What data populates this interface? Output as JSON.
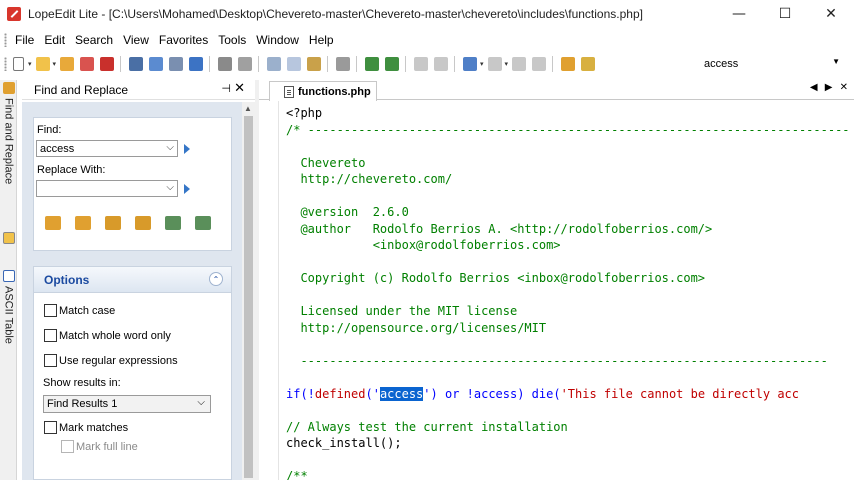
{
  "window": {
    "title": "LopeEdit Lite - [C:\\Users\\Mohamed\\Desktop\\Chevereto-master\\Chevereto-master\\chevereto\\includes\\functions.php]",
    "minimize": "—",
    "maximize": "☐",
    "close": "✕"
  },
  "menu": [
    "File",
    "Edit",
    "Search",
    "View",
    "Favorites",
    "Tools",
    "Window",
    "Help"
  ],
  "toolbar": {
    "search_value": "access",
    "icons": [
      "new-file-icon",
      "open-icon",
      "open-folder-icon",
      "close-icon",
      "close-all-icon",
      "save-icon",
      "save-as-icon",
      "save-all-icon",
      "project-icon",
      "print-icon",
      "print-preview-icon",
      "cut-icon",
      "copy-icon",
      "paste-icon",
      "select-all-icon",
      "indent-icon",
      "outdent-icon",
      "undo-icon",
      "redo-icon",
      "bookmark-icon",
      "next-bookmark-icon",
      "clear-bookmarks-icon",
      "find-icon",
      "find-in-files-icon"
    ]
  },
  "side_tabs": {
    "find_replace": "Find and Replace",
    "ascii_table": "ASCII Table"
  },
  "find_panel": {
    "title": "Find and Replace",
    "pin": "⊣",
    "close": "✕",
    "find_label": "Find:",
    "find_value": "access",
    "replace_label": "Replace With:",
    "replace_value": ""
  },
  "options": {
    "title": "Options",
    "match_case": "Match case",
    "match_whole_word": "Match whole word only",
    "use_regex": "Use regular expressions",
    "show_results_label": "Show results in:",
    "show_results_value": "Find Results 1",
    "mark_matches": "Mark matches",
    "mark_full_line": "Mark full line"
  },
  "editor": {
    "tab_label": "functions.php",
    "tab_nav": "◀ ▶ ✕",
    "lines": [
      [
        {
          "t": "<?php",
          "c": "plain"
        }
      ],
      [
        {
          "t": "/* ---------------------------------------------------------------------------",
          "c": "comment"
        }
      ],
      [
        {
          "t": "",
          "c": "plain"
        }
      ],
      [
        {
          "t": "  Chevereto",
          "c": "comment"
        }
      ],
      [
        {
          "t": "  http://chevereto.com/",
          "c": "comment"
        }
      ],
      [
        {
          "t": "",
          "c": "plain"
        }
      ],
      [
        {
          "t": "  @version  2.6.0",
          "c": "comment"
        }
      ],
      [
        {
          "t": "  @author   Rodolfo Berrios A. <http://rodolfoberrios.com/>",
          "c": "comment"
        }
      ],
      [
        {
          "t": "            <inbox@rodolfoberrios.com>",
          "c": "comment"
        }
      ],
      [
        {
          "t": "",
          "c": "plain"
        }
      ],
      [
        {
          "t": "  Copyright (c) Rodolfo Berrios <inbox@rodolfoberrios.com>",
          "c": "comment"
        }
      ],
      [
        {
          "t": "",
          "c": "plain"
        }
      ],
      [
        {
          "t": "  Licensed under the MIT license",
          "c": "comment"
        }
      ],
      [
        {
          "t": "  http://opensource.org/licenses/MIT",
          "c": "comment"
        }
      ],
      [
        {
          "t": "",
          "c": "plain"
        }
      ],
      [
        {
          "t": "  -------------------------------------------------------------------------",
          "c": "comment"
        }
      ],
      [
        {
          "t": "",
          "c": "plain"
        }
      ],
      [
        {
          "t": "if(!",
          "c": "kw"
        },
        {
          "t": "defined",
          "c": "str"
        },
        {
          "t": "('",
          "c": "kw"
        },
        {
          "t": "access",
          "c": "sel"
        },
        {
          "t": "') or !access) die(",
          "c": "kw"
        },
        {
          "t": "'This file cannot be directly acc",
          "c": "str"
        }
      ],
      [
        {
          "t": "",
          "c": "plain"
        }
      ],
      [
        {
          "t": "// Always test the current installation",
          "c": "comment"
        }
      ],
      [
        {
          "t": "check_install();",
          "c": "plain"
        }
      ],
      [
        {
          "t": "",
          "c": "plain"
        }
      ],
      [
        {
          "t": "/**",
          "c": "comment"
        }
      ]
    ]
  },
  "colors": {
    "comment": "#008000",
    "keyword": "#0000ff",
    "string": "#c00000",
    "selection": "#0a64d0",
    "options_title": "#1b4aa0",
    "panel_bg": "#dfe6ef"
  }
}
